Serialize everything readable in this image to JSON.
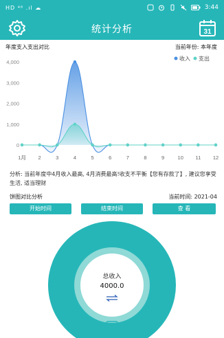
{
  "status_bar": {
    "left_text": "HD ⁴⁶ .ıl ☁",
    "time": "3:44"
  },
  "app_bar": {
    "title": "统计分析",
    "settings_icon": "gear-icon",
    "calendar_icon": "calendar-icon",
    "calendar_day": "31"
  },
  "annual_section": {
    "title": "年度支入支出对比",
    "year_label": "当前年份: 本年度"
  },
  "chart_data": {
    "type": "line",
    "x": [
      "1月",
      "2",
      "3",
      "4",
      "5",
      "6",
      "7",
      "8",
      "9",
      "10",
      "11",
      "12"
    ],
    "series": [
      {
        "name": "收入",
        "color": "#4a90e2",
        "values": [
          0,
          0,
          0,
          4000,
          0,
          0,
          0,
          0,
          0,
          0,
          0,
          0
        ]
      },
      {
        "name": "支出",
        "color": "#5fd3c6",
        "values": [
          0,
          0,
          0,
          1000,
          0,
          0,
          0,
          0,
          0,
          0,
          0,
          0
        ]
      }
    ],
    "y_ticks": [
      "0",
      "1,000",
      "2,000",
      "3,000",
      "4,000"
    ],
    "ylim": [
      0,
      4000
    ],
    "grid": false,
    "legend_position": "top-right",
    "title": "",
    "xlabel": "",
    "ylabel": ""
  },
  "analysis_text": "分析: 当前年度中4月收入最高, 4月消费最高!收支不平衡【您有存款了】, 建议您享受生活, 适当理财",
  "pie_section": {
    "title": "饼图对比分析",
    "time_label": "当前时间: 2021-04"
  },
  "buttons": {
    "start_time": "开始时间",
    "end_time": "结束时间",
    "query": "查 看"
  },
  "ring": {
    "label": "总收入",
    "value": "4000.0",
    "switch_icon": "switch-arrows-icon",
    "outer_color": "#26b6b8",
    "mid_color": "#8fd9d6"
  },
  "bottom": {
    "icon": "book-icon"
  },
  "colors": {
    "primary": "#26b6b8",
    "income": "#4a90e2",
    "expense": "#5fd3c6"
  }
}
